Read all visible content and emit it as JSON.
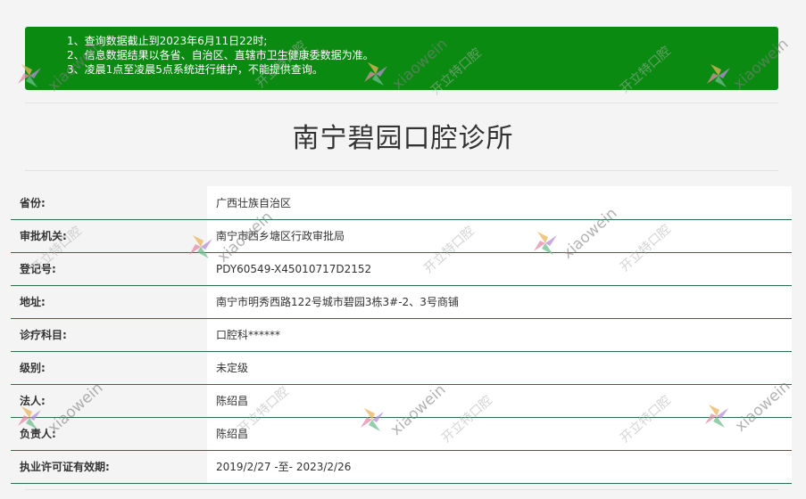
{
  "notice": {
    "lines": [
      "1、查询数据截止到2023年6月11日22时;",
      "2、信息数据结果以各省、自治区、直辖市卫生健康委数据为准。",
      "3、凌晨1点至凌晨5点系统进行维护，不能提供查询。"
    ],
    "background_color": "#0b8a12"
  },
  "page": {
    "title": "南宁碧园口腔诊所"
  },
  "info": {
    "rows": [
      {
        "label": "省份:",
        "value": "广西壮族自治区"
      },
      {
        "label": "审批机关:",
        "value": "南宁市西乡塘区行政审批局"
      },
      {
        "label": "登记号:",
        "value": "PDY60549-X45010717D2152"
      },
      {
        "label": "地址:",
        "value": "南宁市明秀西路122号城市碧园3栋3#-2、3号商铺"
      },
      {
        "label": "诊疗科目:",
        "value": "口腔科******"
      },
      {
        "label": "级别:",
        "value": "未定级"
      },
      {
        "label": "法人:",
        "value": "陈绍昌"
      },
      {
        "label": "负责人:",
        "value": "陈绍昌"
      },
      {
        "label": "执业许可证有效期:",
        "value": "2019/2/27 -至- 2023/2/26"
      }
    ]
  },
  "watermark": {
    "text_en": "xiaowein",
    "text_cn": "开立特口腔",
    "icon": "flower-logo-icon"
  }
}
